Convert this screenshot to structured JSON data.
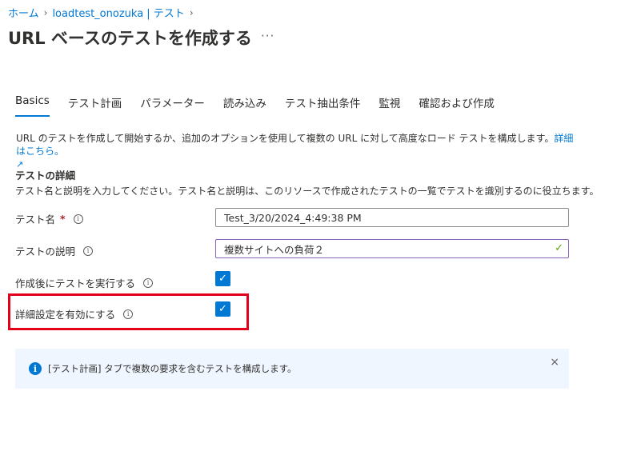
{
  "breadcrumb": {
    "items": [
      "ホーム",
      "loadtest_onozuka | テスト"
    ]
  },
  "page": {
    "title": "URL ベースのテストを作成する",
    "more": "···"
  },
  "tabs": [
    "Basics",
    "テスト計画",
    "パラメーター",
    "読み込み",
    "テスト抽出条件",
    "監視",
    "確認および作成"
  ],
  "intro": {
    "text": "URL のテストを作成して開始するか、追加のオプションを使用して複数の URL に対して高度なロード テストを構成します。",
    "link": "詳細はこちら。",
    "ext_icon": "↗"
  },
  "section": {
    "title": "テストの詳細",
    "description": "テスト名と説明を入力してください。テスト名と説明は、このリソースで作成されたテストの一覧でテストを識別するのに役立ちます。"
  },
  "form": {
    "test_name_label": "テスト名",
    "required_mark": "*",
    "test_name_value": "Test_3/20/2024_4:49:38 PM",
    "test_desc_label": "テストの説明",
    "test_desc_value": "複数サイトへの負荷２",
    "run_after_label": "作成後にテストを実行する",
    "run_after_checked": true,
    "advanced_label": "詳細設定を有効にする",
    "advanced_checked": true,
    "info_glyph": "i",
    "check_glyph": "✓"
  },
  "info_bar": {
    "text": "[テスト計画] タブで複数の要求を含むテストを構成します。",
    "icon": "i",
    "close": "×"
  },
  "colors": {
    "accent": "#0078d4",
    "highlight": "#e3001b",
    "valid": "#57a300"
  }
}
